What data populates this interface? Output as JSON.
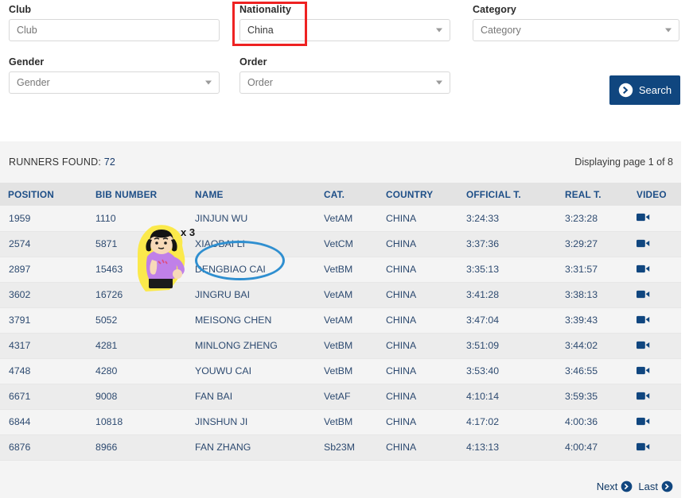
{
  "form": {
    "club": {
      "label": "Club",
      "placeholder": "Club",
      "value": ""
    },
    "nationality": {
      "label": "Nationality",
      "placeholder": "Nationality",
      "value": "China"
    },
    "category": {
      "label": "Category",
      "placeholder": "Category",
      "value": ""
    },
    "gender": {
      "label": "Gender",
      "placeholder": "Gender",
      "value": ""
    },
    "order": {
      "label": "Order",
      "placeholder": "Order",
      "value": ""
    },
    "search_label": "Search",
    "search_icon": "circle-arrow-right-icon"
  },
  "annotations": {
    "red_box_target": "nationality-field",
    "red_color": "#ee2222",
    "blue_ellipse_target": "name-cells",
    "blue_color": "#2f8fd0",
    "sticker": {
      "name": "cartoon-girl-sticker",
      "badge": "x 3"
    }
  },
  "results": {
    "found_label": "RUNNERS FOUND:",
    "found_count": "72",
    "paging_text": "Displaying page 1 of 8",
    "columns": [
      "POSITION",
      "BIB NUMBER",
      "NAME",
      "CAT.",
      "COUNTRY",
      "OFFICIAL T.",
      "REAL T.",
      "VIDEO"
    ],
    "rows": [
      {
        "position": "1959",
        "bib": "1110",
        "name": "JINJUN WU",
        "cat": "VetAM",
        "country": "CHINA",
        "official": "3:24:33",
        "real": "3:23:28",
        "video": "video-icon"
      },
      {
        "position": "2574",
        "bib": "5871",
        "name": "XIAOBAI LI",
        "cat": "VetCM",
        "country": "CHINA",
        "official": "3:37:36",
        "real": "3:29:27",
        "video": "video-icon"
      },
      {
        "position": "2897",
        "bib": "15463",
        "name": "DENGBIAO CAI",
        "cat": "VetBM",
        "country": "CHINA",
        "official": "3:35:13",
        "real": "3:31:57",
        "video": "video-icon"
      },
      {
        "position": "3602",
        "bib": "16726",
        "name": "JINGRU BAI",
        "cat": "VetAM",
        "country": "CHINA",
        "official": "3:41:28",
        "real": "3:38:13",
        "video": "video-icon"
      },
      {
        "position": "3791",
        "bib": "5052",
        "name": "MEISONG CHEN",
        "cat": "VetAM",
        "country": "CHINA",
        "official": "3:47:04",
        "real": "3:39:43",
        "video": "video-icon"
      },
      {
        "position": "4317",
        "bib": "4281",
        "name": "MINLONG ZHENG",
        "cat": "VetBM",
        "country": "CHINA",
        "official": "3:51:09",
        "real": "3:44:02",
        "video": "video-icon"
      },
      {
        "position": "4748",
        "bib": "4280",
        "name": "YOUWU CAI",
        "cat": "VetBM",
        "country": "CHINA",
        "official": "3:53:40",
        "real": "3:46:55",
        "video": "video-icon"
      },
      {
        "position": "6671",
        "bib": "9008",
        "name": "FAN BAI",
        "cat": "VetAF",
        "country": "CHINA",
        "official": "4:10:14",
        "real": "3:59:35",
        "video": "video-icon"
      },
      {
        "position": "6844",
        "bib": "10818",
        "name": "JINSHUN JI",
        "cat": "VetBM",
        "country": "CHINA",
        "official": "4:17:02",
        "real": "4:00:36",
        "video": "video-icon"
      },
      {
        "position": "6876",
        "bib": "8966",
        "name": "FAN ZHANG",
        "cat": "Sb23M",
        "country": "CHINA",
        "official": "4:13:13",
        "real": "4:00:47",
        "video": "video-icon"
      }
    ]
  },
  "pagination": {
    "next_label": "Next",
    "last_label": "Last",
    "arrow_icon": "circle-arrow-right-icon"
  },
  "colors": {
    "accent_navy": "#10467f",
    "link_blue": "#2d4a70",
    "header_blue": "#1d4e87",
    "panel_bg": "#f4f4f4"
  }
}
